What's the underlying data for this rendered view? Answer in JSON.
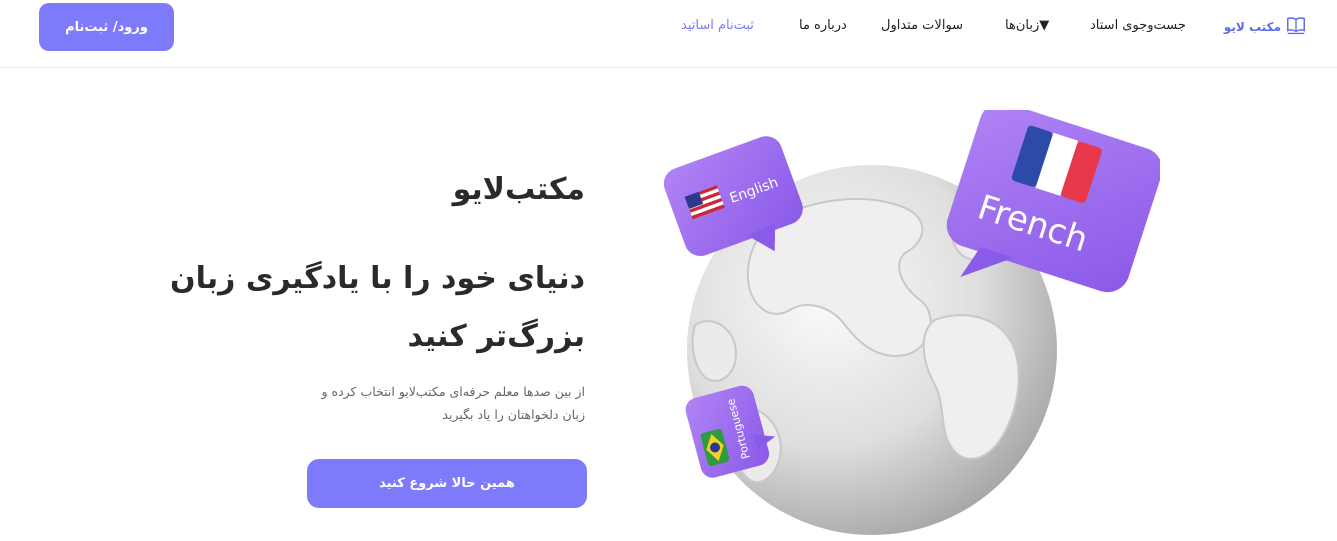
{
  "header": {
    "login_label": "ورود/ ثبت‌نام",
    "nav": {
      "teacher_signup": "ثبت‌نام اساتید",
      "about": "درباره ما",
      "faq": "سوالات متداول",
      "languages": "زبان‌ها▼",
      "search_teacher": "جست‌وجوی استاد"
    },
    "logo_text": "مکتب لایو"
  },
  "hero": {
    "brand": "مکتب‌لایو",
    "headline_line1": "دنیای خود را با یادگیری زبان",
    "headline_line2": "بزرگ‌تر کنید",
    "desc_line1": "از بین صدها معلم حرفه‌ای مکتب‌لایو انتخاب کرده و",
    "desc_line2": "زبان دلخواهتان را یاد بگیرید",
    "cta_label": "همین حالا شروع کنید"
  },
  "illustration": {
    "bubbles": {
      "english": "English",
      "french": "French",
      "portuguese": "Portuguese"
    }
  },
  "colors": {
    "accent": "#7e7bfb",
    "bubble": "#9b6cf0",
    "logo": "#5e6ae8"
  }
}
